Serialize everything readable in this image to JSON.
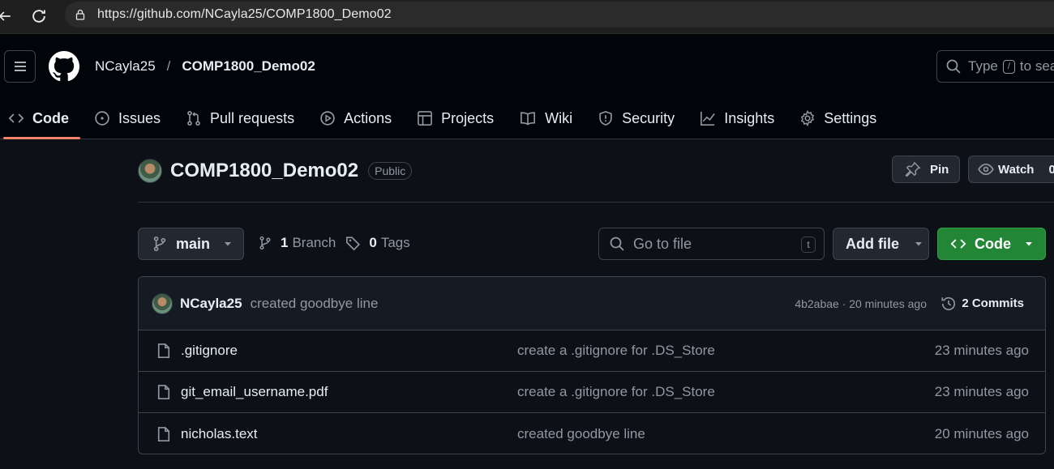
{
  "browser": {
    "url": "https://github.com/NCayla25/COMP1800_Demo02",
    "icons": [
      "back-icon",
      "reload-icon",
      "lock-icon"
    ]
  },
  "header": {
    "owner": "NCayla25",
    "separator": "/",
    "repo": "COMP1800_Demo02",
    "search_prefix": "Type",
    "search_key": "/",
    "search_suffix": "to sea"
  },
  "nav": {
    "tabs": [
      {
        "label": "Code",
        "icon": "code-icon"
      },
      {
        "label": "Issues",
        "icon": "issue-icon"
      },
      {
        "label": "Pull requests",
        "icon": "pull-request-icon"
      },
      {
        "label": "Actions",
        "icon": "play-icon"
      },
      {
        "label": "Projects",
        "icon": "table-icon"
      },
      {
        "label": "Wiki",
        "icon": "book-icon"
      },
      {
        "label": "Security",
        "icon": "shield-icon"
      },
      {
        "label": "Insights",
        "icon": "graph-icon"
      },
      {
        "label": "Settings",
        "icon": "gear-icon"
      }
    ]
  },
  "repo": {
    "name": "COMP1800_Demo02",
    "visibility": "Public",
    "pin_label": "Pin",
    "watch_label": "Watch",
    "watch_count": "0"
  },
  "toolbar": {
    "branch": "main",
    "branch_count": "1",
    "branch_label": "Branch",
    "tag_count": "0",
    "tag_label": "Tags",
    "goto_placeholder": "Go to file",
    "goto_key": "t",
    "add_file_label": "Add file",
    "code_label": "Code"
  },
  "latest_commit": {
    "author": "NCayla25",
    "message": "created goodbye line",
    "meta": "4b2abae · 20 minutes ago",
    "commits_label": "2 Commits"
  },
  "files": [
    {
      "name": ".gitignore",
      "commit": "create a .gitignore for .DS_Store",
      "age": "23 minutes ago"
    },
    {
      "name": "git_email_username.pdf",
      "commit": "create a .gitignore for .DS_Store",
      "age": "23 minutes ago"
    },
    {
      "name": "nicholas.text",
      "commit": "created goodbye line",
      "age": "20 minutes ago"
    }
  ],
  "colors": {
    "background": "#0d1117",
    "header": "#010409",
    "accent_underline": "#f78166",
    "code_button": "#238636"
  }
}
